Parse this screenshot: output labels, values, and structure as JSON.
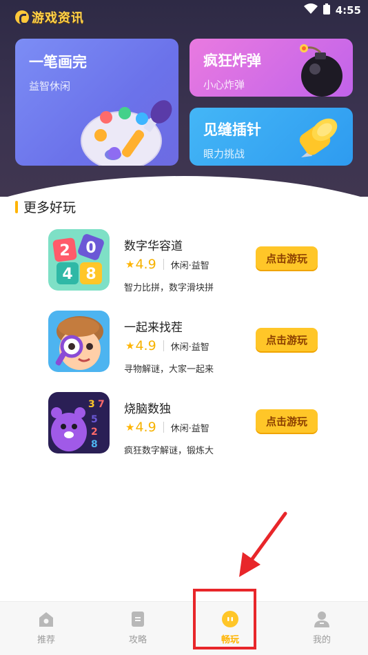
{
  "status_bar": {
    "time": "4:55",
    "wifi_icon": "wifi-icon",
    "battery_icon": "battery-icon"
  },
  "header": {
    "app_title": "游戏资讯",
    "logo_icon": "logo-icon"
  },
  "featured": [
    {
      "title": "一笔画完",
      "subtitle": "益智休闲",
      "icon": "palette-icon"
    },
    {
      "title": "疯狂炸弹",
      "subtitle": "小心炸弹",
      "icon": "bomb-icon"
    },
    {
      "title": "见缝插针",
      "subtitle": "眼力挑战",
      "icon": "pin-icon"
    }
  ],
  "section": {
    "title": "更多好玩"
  },
  "games": [
    {
      "name": "数字华容道",
      "rating": "4.9",
      "category": "休闲·益智",
      "description": "智力比拼，数字滑块拼",
      "button": "点击游玩",
      "icon": "number-blocks-icon"
    },
    {
      "name": "一起来找茬",
      "rating": "4.9",
      "category": "休闲·益智",
      "description": "寻物解谜，大家一起来",
      "button": "点击游玩",
      "icon": "magnifier-boy-icon"
    },
    {
      "name": "烧脑数独",
      "rating": "4.9",
      "category": "休闲·益智",
      "description": "疯狂数字解谜，锻炼大",
      "button": "点击游玩",
      "icon": "sudoku-monster-icon"
    }
  ],
  "bottom_nav": [
    {
      "label": "推荐",
      "icon": "home-icon",
      "active": false
    },
    {
      "label": "攻略",
      "icon": "guide-icon",
      "active": false
    },
    {
      "label": "畅玩",
      "icon": "play-icon",
      "active": true
    },
    {
      "label": "我的",
      "icon": "profile-icon",
      "active": false
    }
  ],
  "colors": {
    "accent": "#ffc628",
    "active_tab": "#ffb400",
    "annotation": "#e8262a",
    "hero_bg": "#2e2a45"
  }
}
